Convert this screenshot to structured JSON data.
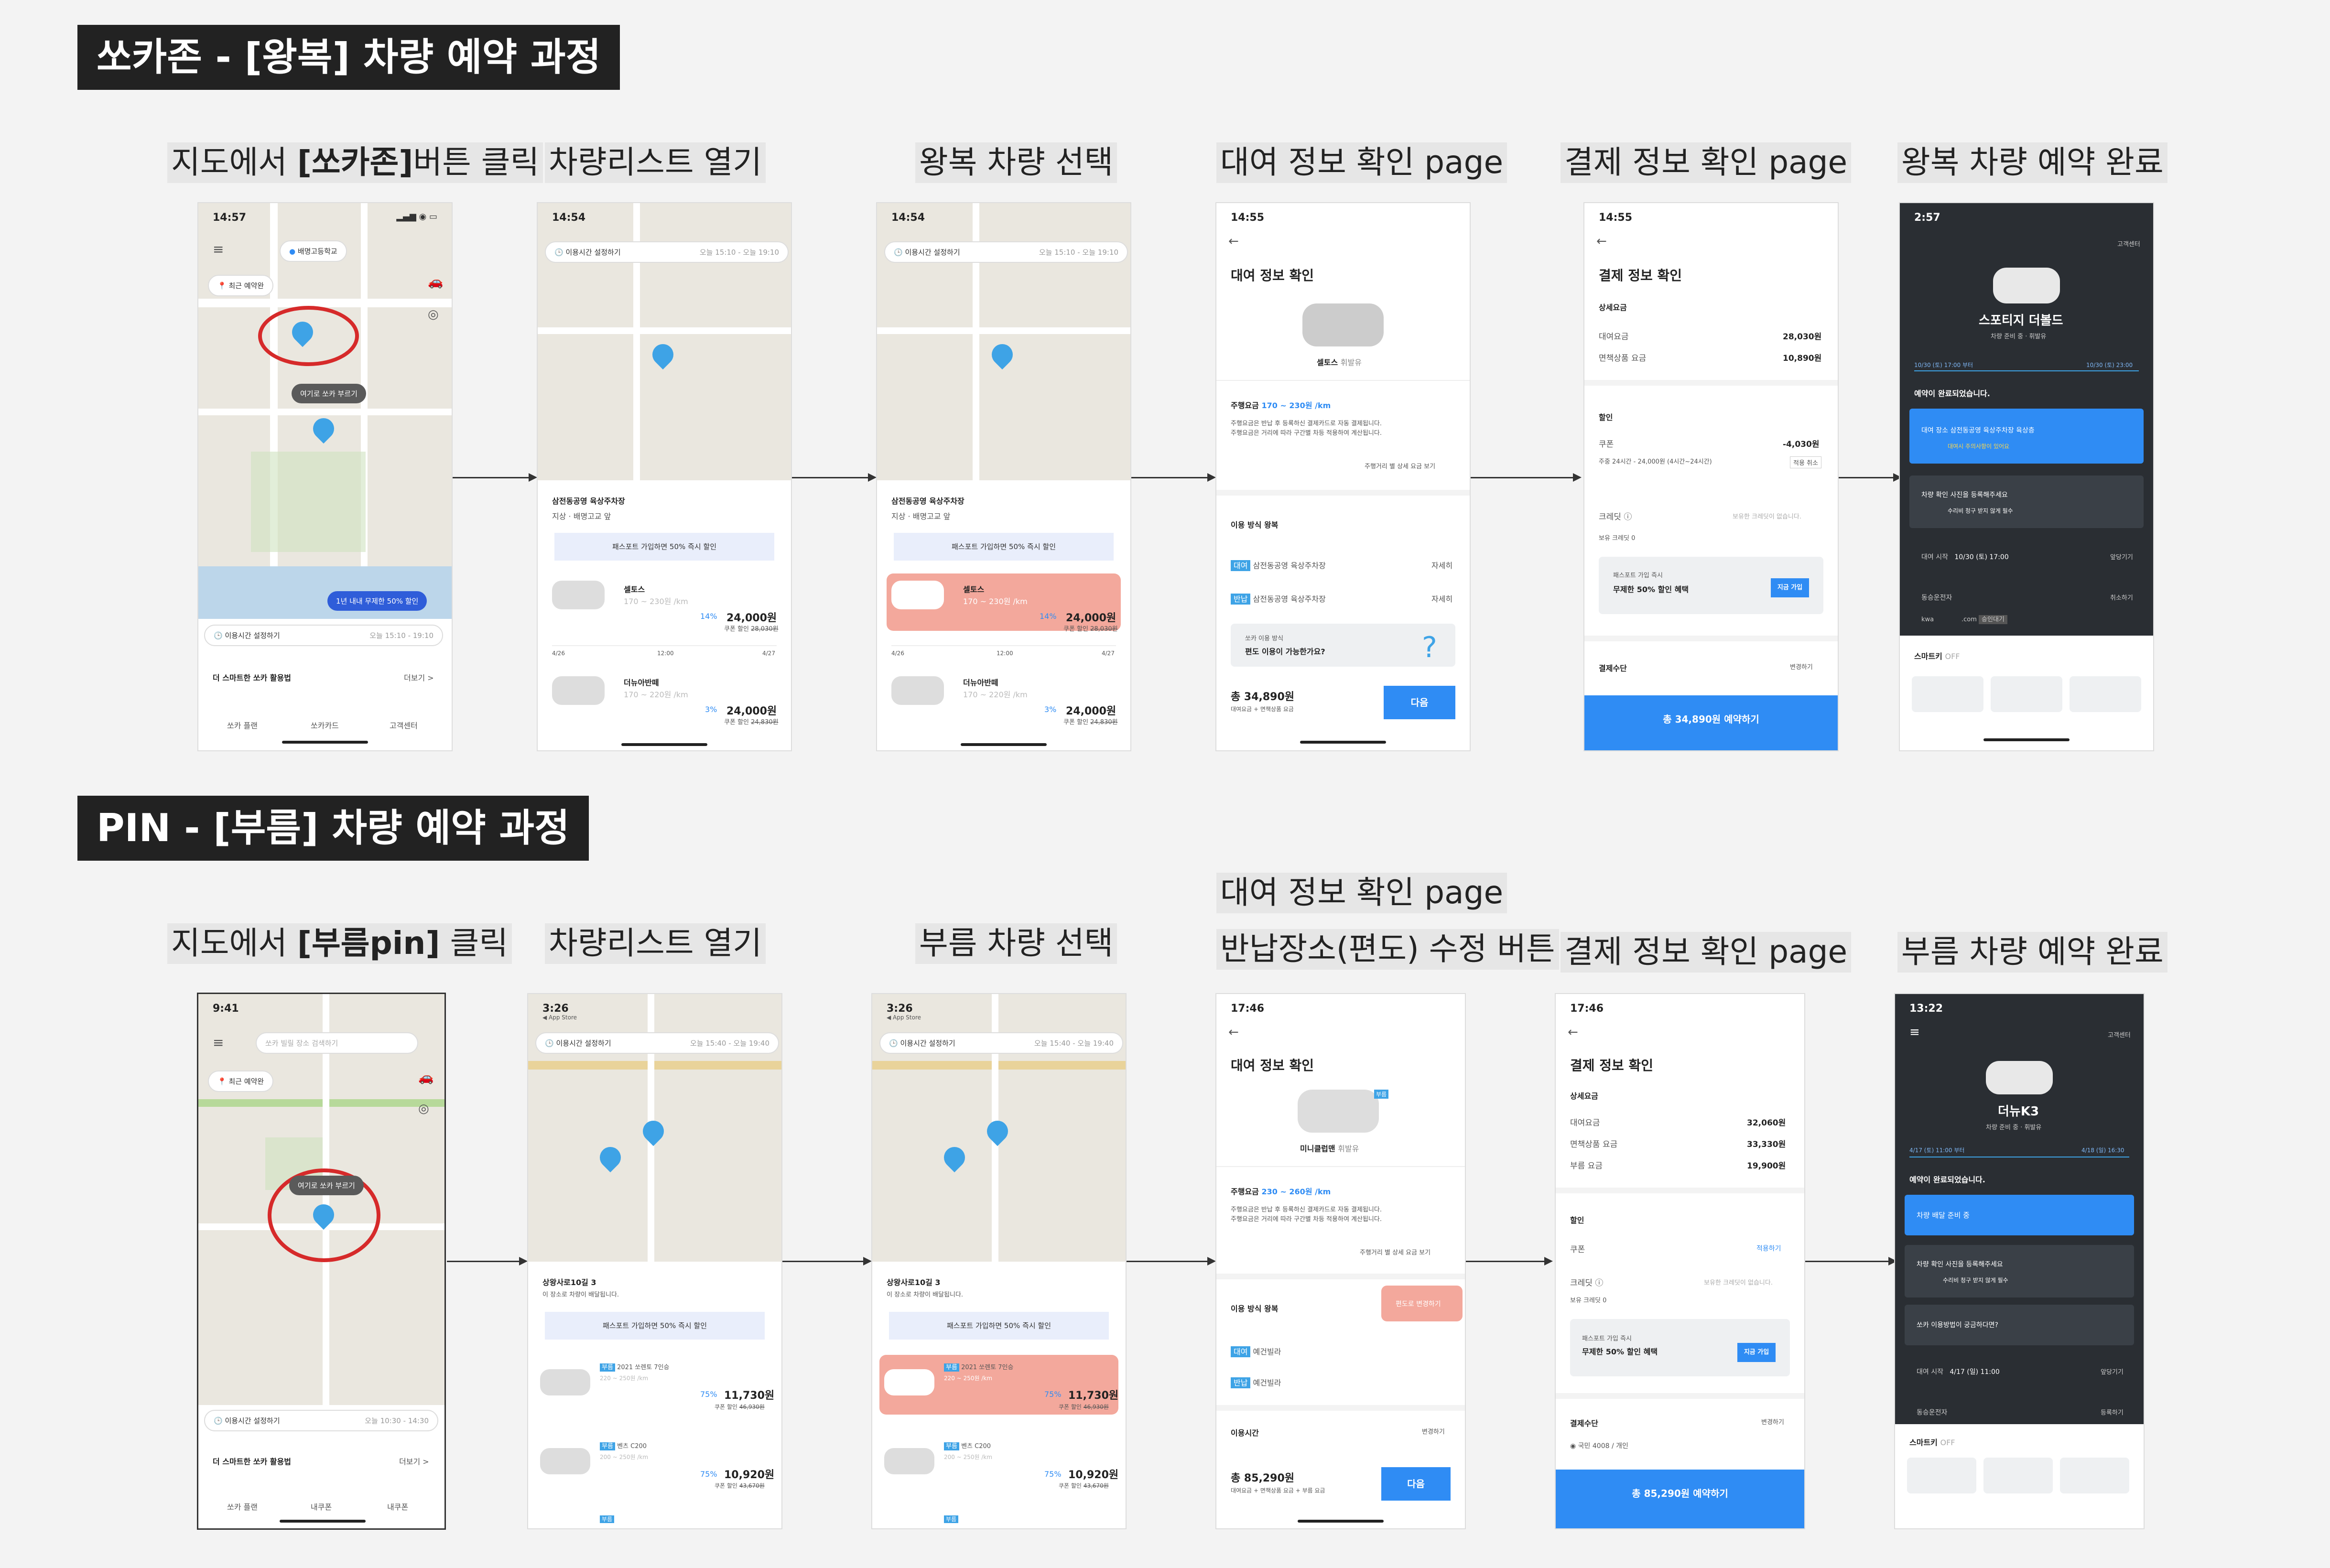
{
  "sections": [
    {
      "title": "쏘카존 - [왕복] 차량 예약 과정"
    },
    {
      "title": "PIN - [부름] 차량 예약 과정"
    }
  ],
  "row1_steps": [
    {
      "pre": "지도에서 ",
      "bold": "[쏘카존]",
      "post": "버튼 클릭"
    },
    {
      "label": "차량리스트 열기"
    },
    {
      "label": "왕복 차량 선택"
    },
    {
      "label": "대여 정보 확인 page"
    },
    {
      "label": "결제 정보 확인 page"
    },
    {
      "label": "왕복 차량 예약 완료"
    }
  ],
  "row2_steps": [
    {
      "pre": "지도에서 ",
      "bold": "[부름pin]",
      "post": " 클릭"
    },
    {
      "label": "차량리스트 열기"
    },
    {
      "label": "부름 차량 선택"
    },
    {
      "label": "대여 정보 확인 page",
      "label2": "반납장소(편도) 수정 버튼"
    },
    {
      "label": "결제 정보 확인 page"
    },
    {
      "label": "부름 차량 예약 완료"
    }
  ],
  "r1p1": {
    "time": "14:57",
    "search": "배명고등학교",
    "recent": "최근 예약완",
    "pill": "여기로 쏘카 부르기",
    "promo": "1년 내내 무제한 50% 할인",
    "time_setting": "이용시간 설정하기",
    "time_range": "오늘 15:10 - 19:10",
    "bottom_title": "더 스마트한 쏘카 활용법",
    "more": "더보기 >",
    "icons": [
      "쏘카 플랜",
      "쏘카카드",
      "고객센터"
    ]
  },
  "r1p2": {
    "time": "14:54",
    "time_setting": "이용시간 설정하기",
    "time_range": "오늘 15:10 - 오늘 19:10",
    "place": "삼전동공영 육상주차장",
    "place_tags": [
      "지상",
      "배명고교 앞"
    ],
    "banner": "패스포트 가입하면 50% 즉시 할인",
    "cars": [
      {
        "name": "셀토스",
        "sub": "170 ~ 230원 /km",
        "discount": "14%",
        "price": "24,000원",
        "coupon": "쿠폰 할인",
        "old": "28,030원"
      },
      {
        "name": "더뉴아반떼",
        "sub": "170 ~ 220원 /km",
        "discount": "3%",
        "price": "24,000원",
        "coupon": "쿠폰 할인",
        "old": "24,830원"
      }
    ],
    "axis": [
      "4/26",
      "12:00",
      "4/27"
    ]
  },
  "r1p3": {
    "time": "14:54",
    "time_setting": "이용시간 설정하기",
    "time_range": "오늘 15:10 - 오늘 19:10",
    "place": "삼전동공영 육상주차장",
    "place_tags": [
      "지상",
      "배명고교 앞"
    ],
    "banner": "패스포트 가입하면 50% 즉시 할인",
    "cars": [
      {
        "name": "셀토스",
        "sub": "170 ~ 230원 /km",
        "discount": "14%",
        "price": "24,000원",
        "coupon": "쿠폰 할인",
        "old": "28,030원"
      },
      {
        "name": "더뉴아반떼",
        "sub": "170 ~ 220원 /km",
        "discount": "3%",
        "price": "24,000원",
        "coupon": "쿠폰 할인",
        "old": "24,830원"
      }
    ],
    "axis": [
      "4/26",
      "12:00",
      "4/27"
    ]
  },
  "r1p4": {
    "time": "14:55",
    "title": "대여 정보 확인",
    "car_name": "셀토스",
    "car_sub": "휘발유",
    "fuel_label": "주행요금",
    "fuel_value": "170 ~ 230원 /km",
    "note1": "주행요금은 반납 후 등록하신 결제카드로 자동 결제됩니다.",
    "note2": "주행요금은 거리에 따라 구간별 차등 적용하여 계산됩니다.",
    "detail_link": "주행거리 별 상세 요금 보기",
    "method_title": "이용 방식 왕복",
    "rows": [
      {
        "tag": "대여",
        "name": "삼전동공영 육상주차장",
        "action": "자세히"
      },
      {
        "tag": "반납",
        "name": "삼전동공영 육상주차장",
        "action": "자세히"
      }
    ],
    "q1": "쏘카 이용 방식",
    "q2": "편도 이용이 가능한가요?",
    "total": "총 34,890원",
    "total_sub": "대여요금 + 면책상품 요금",
    "next": "다음"
  },
  "r1p5": {
    "time": "14:55",
    "title": "결제 정보 확인",
    "detail": "상세요금",
    "rows": [
      {
        "l": "대여요금",
        "r": "28,030원"
      },
      {
        "l": "면책상품 요금",
        "r": "10,890원"
      }
    ],
    "discount": "할인",
    "coupon": "쿠폰",
    "coupon_value": "-4,030원",
    "coupon_sub": "주중 24시간 - 24,000원 (4시간~24시간)",
    "coupon_btn": "적용 취소",
    "credit": "크레딧",
    "credit_note": "보유한 크레딧이 없습니다.",
    "credit_sub": "보유 크레딧 0",
    "passport1": "패스포트 가입 즉시",
    "passport2": "무제한 50% 할인 혜택",
    "passport_btn": "지금 가입",
    "pay": "결제수단",
    "change": "변경하기",
    "pay_btn": "총 34,890원 예약하기"
  },
  "r1p6": {
    "time": "2:57",
    "help": "고객센터",
    "car": "스포티지 더볼드",
    "car_sub": "차량 준비 중 · 휘발유",
    "range_l": "10/30 (토) 17:00 부터",
    "range_r": "10/30 (토) 23:00",
    "done": "예약이 완료되었습니다.",
    "card1_tag": "대여 장소",
    "card1": "삼전동공영 육상주차장 육상층",
    "card1_warn": "대여시 주의사항이 있어요",
    "card2_tag": "차량 확인",
    "card2": "사진을 등록해주세요",
    "card2_warn": "수리비 청구 받지 않게 필수",
    "row1_l": "대여 시작",
    "row1_v": "10/30 (토) 17:00",
    "row1_r": "앞당기기",
    "row2_l": "동승운전자",
    "row2_r": "취소하기",
    "row3_l": "kwa",
    "row3_m": ".com",
    "row3_r": "승인대기",
    "smartkey": "스마트키",
    "off": "OFF"
  },
  "r2p1": {
    "time": "9:41",
    "search": "쏘카 빌릴 장소 검색하기",
    "recent": "최근 예약완",
    "pill": "여기로 쏘카 부르기",
    "time_setting": "이용시간 설정하기",
    "time_range": "오늘 10:30 - 14:30",
    "bottom_title": "더 스마트한 쏘카 활용법",
    "more": "더보기 >",
    "icons": [
      "쏘카 플랜",
      "내쿠폰",
      "내쿠폰"
    ]
  },
  "r2p2": {
    "time": "3:26",
    "store": "App Store",
    "time_setting": "이용시간 설정하기",
    "time_range": "오늘 15:40 - 오늘 19:40",
    "place": "상왕사로10길 3",
    "place_sub": "이 장소로 차량이 배달됩니다.",
    "banner": "패스포트 가입하면 50% 즉시 할인",
    "cars": [
      {
        "tag": "부름",
        "name": "2021 쏘렌토 7인승",
        "sub": "220 ~ 250원 /km",
        "discount": "75%",
        "price": "11,730원",
        "coupon": "쿠폰 할인",
        "old": "46,930원"
      },
      {
        "tag": "부름",
        "name": "벤츠 C200",
        "sub": "200 ~ 250원 /km",
        "discount": "75%",
        "price": "10,920원",
        "coupon": "쿠폰 할인",
        "old": "43,670원"
      }
    ],
    "third": "부름"
  },
  "r2p3": {
    "time": "3:26",
    "store": "App Store",
    "time_setting": "이용시간 설정하기",
    "time_range": "오늘 15:40 - 오늘 19:40",
    "place": "상왕사로10길 3",
    "place_sub": "이 장소로 차량이 배달됩니다.",
    "banner": "패스포트 가입하면 50% 즉시 할인",
    "cars": [
      {
        "tag": "부름",
        "name": "2021 쏘렌토 7인승",
        "sub": "220 ~ 250원 /km",
        "discount": "75%",
        "price": "11,730원",
        "coupon": "쿠폰 할인",
        "old": "46,930원"
      },
      {
        "tag": "부름",
        "name": "벤츠 C200",
        "sub": "200 ~ 250원 /km",
        "discount": "75%",
        "price": "10,920원",
        "coupon": "쿠폰 할인",
        "old": "43,670원"
      }
    ],
    "third": "부름"
  },
  "r2p4": {
    "time": "17:46",
    "title": "대여 정보 확인",
    "car_name": "미니클럽맨",
    "car_sub": "휘발유",
    "car_tag": "부름",
    "fuel_label": "주행요금",
    "fuel_value": "230 ~ 260원 /km",
    "note1": "주행요금은 반납 후 등록하신 결제카드로 자동 결제됩니다.",
    "note2": "주행요금은 거리에 따라 구간별 차등 적용하여 계산됩니다.",
    "detail_link": "주행거리 별 상세 요금 보기",
    "method_title": "이용 방식 왕복",
    "method_btn": "편도로 변경하기",
    "rows": [
      {
        "tag": "대여",
        "name": "예건빌라"
      },
      {
        "tag": "반납",
        "name": "예건빌라"
      }
    ],
    "usage": "이용시간",
    "change": "변경하기",
    "total": "총 85,290원",
    "total_sub": "대여요금 + 면책상품 요금 + 부름 요금",
    "next": "다음"
  },
  "r2p5": {
    "time": "17:46",
    "title": "결제 정보 확인",
    "detail": "상세요금",
    "rows": [
      {
        "l": "대여요금",
        "r": "32,060원"
      },
      {
        "l": "면책상품 요금",
        "r": "33,330원"
      },
      {
        "l": "부름 요금",
        "r": "19,900원"
      }
    ],
    "discount": "할인",
    "coupon": "쿠폰",
    "coupon_value": "적용하기",
    "credit": "크레딧",
    "credit_note": "보유한 크레딧이 없습니다.",
    "credit_sub": "보유 크레딧 0",
    "passport1": "패스포트 가입 즉시",
    "passport2": "무제한 50% 할인 혜택",
    "passport_btn": "지금 가입",
    "pay": "결제수단",
    "change": "변경하기",
    "card": "국민 4008 / 개인",
    "pay_btn": "총 85,290원 예약하기"
  },
  "r2p6": {
    "time": "13:22",
    "help": "고객센터",
    "car": "더뉴K3",
    "car_sub": "차량 준비 중 · 휘발유",
    "range_l": "4/17 (토) 11:00 부터",
    "range_r": "4/18 (일) 16:30",
    "done": "예약이 완료되었습니다.",
    "card1": "차량 배달 준비 중",
    "card2_tag": "차량 확인",
    "card2": "사진을 등록해주세요",
    "card2_warn": "수리비 청구 받지 않게 필수",
    "card3": "쏘카 이용방법이 궁금하다면?",
    "row1_l": "대여 시작",
    "row1_v": "4/17 (일) 11:00",
    "row1_r": "앞당기기",
    "row2_l": "동승운전자",
    "row2_r": "등록하기",
    "smartkey": "스마트키",
    "off": "OFF"
  },
  "colors": {
    "accent": "#2f8cf4",
    "highlight": "#f3a89c",
    "annotation": "#d62a2a",
    "dark": "#2a2e33",
    "title_bg": "#222222"
  }
}
